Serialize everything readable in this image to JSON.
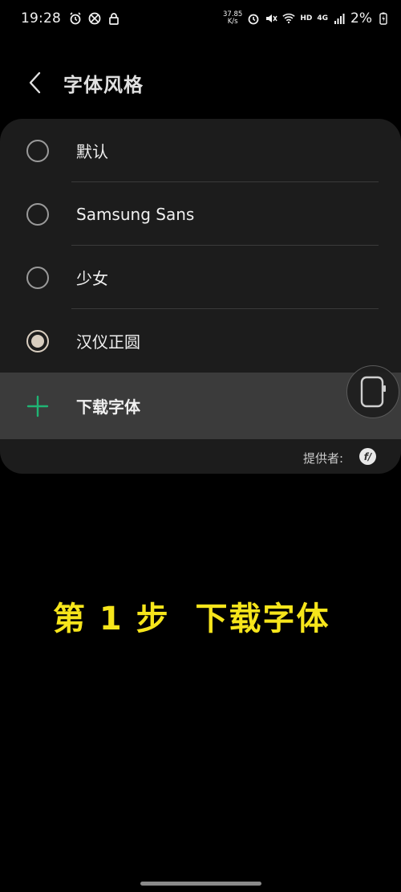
{
  "status_bar": {
    "time": "19:28",
    "net_speed_value": "37.85",
    "net_speed_unit": "K/s",
    "hd_label": "HD",
    "network_label": "4G",
    "battery_percent": "2%"
  },
  "header": {
    "title": "字体风格"
  },
  "font_options": [
    {
      "label": "默认",
      "selected": false
    },
    {
      "label": "Samsung Sans",
      "selected": false
    },
    {
      "label": "少女",
      "selected": false
    },
    {
      "label": "汉仪正圆",
      "selected": true
    }
  ],
  "download": {
    "label": "下载字体"
  },
  "provider": {
    "label": "提供者:",
    "logo_text": "f/"
  },
  "caption": {
    "text": "第 1 步  下载字体"
  },
  "colors": {
    "accent_green": "#1fb574",
    "caption_yellow": "#f6e51b",
    "selected_radio": "#d8cdbf"
  }
}
